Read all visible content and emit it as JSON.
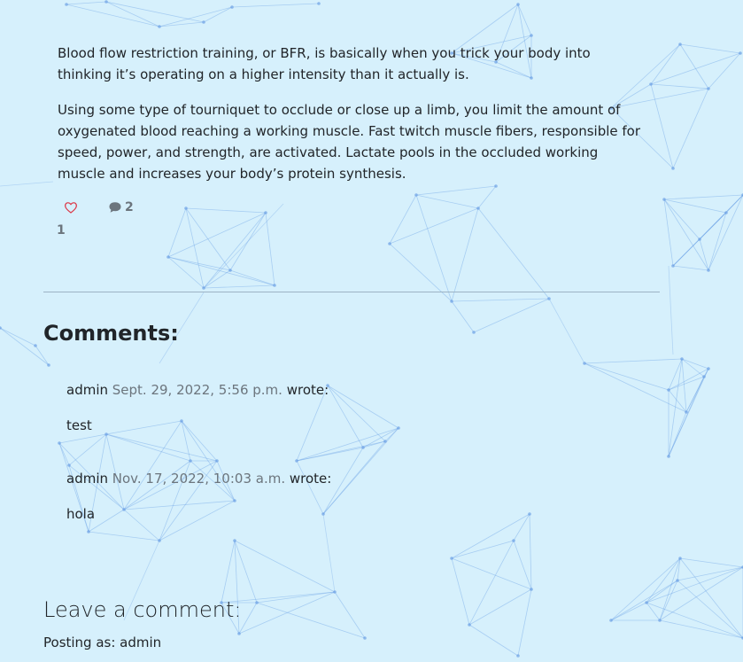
{
  "post": {
    "paragraphs": [
      "Blood flow restriction training, or BFR, is basically when you trick your body into thinking it’s operating on a higher intensity than it actually is.",
      "Using some type of tourniquet to occlude or close up a limb, you limit the amount of oxygenated blood reaching a working muscle. Fast twitch muscle fibers, responsible for speed, power, and strength, are activated. Lactate pools in the occluded working muscle and increases your body’s protein synthesis."
    ],
    "likes": "1",
    "comment_count": "2",
    "like_icon": "heart-outline-icon",
    "comment_icon": "speech-bubble-icon"
  },
  "comments": {
    "heading": "Comments:",
    "wrote_label": "wrote:",
    "items": [
      {
        "author": "admin",
        "date": "Sept. 29, 2022, 5:56 p.m.",
        "body": "test"
      },
      {
        "author": "admin",
        "date": "Nov. 17, 2022, 10:03 a.m.",
        "body": "hola"
      }
    ]
  },
  "comment_form": {
    "heading": "Leave a comment:",
    "posting_as": "Posting as: admin"
  },
  "colors": {
    "background": "#d6f0fc",
    "network_line": "#6fa3e6",
    "heart": "#dc3545",
    "muted": "#6c757d"
  }
}
